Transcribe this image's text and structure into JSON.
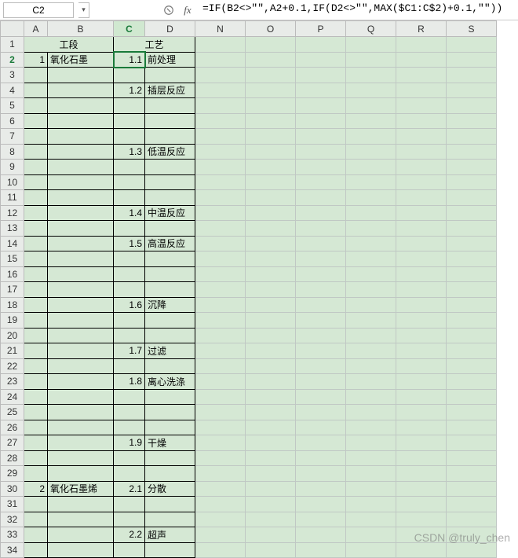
{
  "formula_bar": {
    "cell_ref": "C2",
    "fx_label": "fx",
    "formula": "=IF(B2<>\"\",A2+0.1,IF(D2<>\"\",MAX($C1:C$2)+0.1,\"\"))"
  },
  "columns": [
    "A",
    "B",
    "C",
    "D",
    "N",
    "O",
    "P",
    "Q",
    "R",
    "S"
  ],
  "active": {
    "col": "C",
    "row": 2
  },
  "title": {
    "left": "工段",
    "right": "工艺"
  },
  "rows": [
    {
      "n": 1,
      "title": true
    },
    {
      "n": 2,
      "a": "1",
      "b": "氧化石墨",
      "c": "1.1",
      "d": "前处理"
    },
    {
      "n": 3
    },
    {
      "n": 4,
      "c": "1.2",
      "d": "插层反应"
    },
    {
      "n": 5
    },
    {
      "n": 6
    },
    {
      "n": 7
    },
    {
      "n": 8,
      "c": "1.3",
      "d": "低温反应"
    },
    {
      "n": 9
    },
    {
      "n": 10
    },
    {
      "n": 11
    },
    {
      "n": 12,
      "c": "1.4",
      "d": "中温反应"
    },
    {
      "n": 13
    },
    {
      "n": 14,
      "c": "1.5",
      "d": "高温反应"
    },
    {
      "n": 15
    },
    {
      "n": 16
    },
    {
      "n": 17
    },
    {
      "n": 18,
      "c": "1.6",
      "d": "沉降"
    },
    {
      "n": 19
    },
    {
      "n": 20
    },
    {
      "n": 21,
      "c": "1.7",
      "d": "过滤"
    },
    {
      "n": 22
    },
    {
      "n": 23,
      "c": "1.8",
      "d": "离心洗涤"
    },
    {
      "n": 24
    },
    {
      "n": 25
    },
    {
      "n": 26
    },
    {
      "n": 27,
      "c": "1.9",
      "d": "干燥"
    },
    {
      "n": 28
    },
    {
      "n": 29
    },
    {
      "n": 30,
      "a": "2",
      "b": "氧化石墨烯",
      "c": "2.1",
      "d": "分散"
    },
    {
      "n": 31
    },
    {
      "n": 32
    },
    {
      "n": 33,
      "c": "2.2",
      "d": "超声"
    },
    {
      "n": 34,
      "partial": true
    }
  ],
  "watermark": "CSDN @truly_chen"
}
